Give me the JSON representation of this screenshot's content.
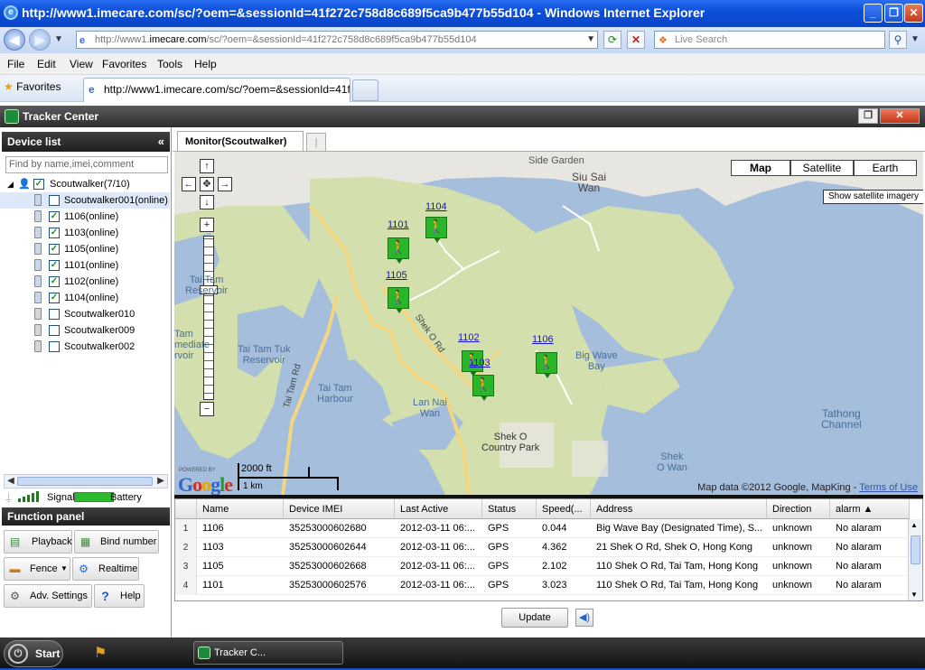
{
  "browser": {
    "title": "http://www1.imecare.com/sc/?oem=&sessionId=41f272c758d8c689f5ca9b477b55d104 - Windows Internet Explorer",
    "address_gray": "http://www1.",
    "address_host": "imecare.com",
    "address_rest": "/sc/?oem=&sessionId=41f272c758d8c689f5ca9b477b55d104",
    "search_placeholder": "Live Search",
    "menu": [
      "File",
      "Edit",
      "View",
      "Favorites",
      "Tools",
      "Help"
    ],
    "favorites_label": "Favorites",
    "tab_title": "http://www1.imecare.com/sc/?oem=&sessionId=41f2..."
  },
  "app": {
    "title": "Tracker Center",
    "device_list_header": "Device list",
    "collapse_icon": "«",
    "find_placeholder": "Find by name,imei,comment",
    "tree": {
      "group": "Scoutwalker(7/10)",
      "devices": [
        {
          "label": "Scoutwalker001(online)",
          "checked": false,
          "online": true,
          "selected": true
        },
        {
          "label": "1106(online)",
          "checked": true,
          "online": true,
          "selected": false
        },
        {
          "label": "1103(online)",
          "checked": true,
          "online": true,
          "selected": false
        },
        {
          "label": "1105(online)",
          "checked": true,
          "online": true,
          "selected": false
        },
        {
          "label": "1101(online)",
          "checked": true,
          "online": true,
          "selected": false
        },
        {
          "label": "1102(online)",
          "checked": true,
          "online": true,
          "selected": false
        },
        {
          "label": "1104(online)",
          "checked": true,
          "online": true,
          "selected": false
        },
        {
          "label": "Scoutwalker010",
          "checked": false,
          "online": false,
          "selected": false
        },
        {
          "label": "Scoutwalker009",
          "checked": false,
          "online": false,
          "selected": false
        },
        {
          "label": "Scoutwalker002",
          "checked": false,
          "online": false,
          "selected": false
        }
      ]
    },
    "signal_label": "Signal",
    "battery_label": "Battery",
    "function_panel_header": "Function panel",
    "functions": {
      "playback": "Playback",
      "bind_number": "Bind number",
      "fence": "Fence",
      "realtime": "Realtime",
      "adv_settings": "Adv. Settings",
      "help": "Help"
    },
    "monitor_tab": "Monitor(Scoutwalker)",
    "monitor_tab2": "|"
  },
  "map": {
    "type_buttons": [
      "Map",
      "Satellite",
      "Earth"
    ],
    "active_type": "Map",
    "tooltip": "Show satellite imagery",
    "labels": {
      "side_garden": "Side Garden",
      "siu_sai_wan": "Siu Sai\nWan",
      "tai_tam_reservoir": "Tai Tam\nReservoir",
      "tai_tam_tuk": "Tai Tam Tuk\nReservoir",
      "tam_mediate": "Tam\nmediate\nrvoir",
      "tai_tam_harbour": "Tai Tam\nHarbour",
      "lan_nai_wan": "Lan Nai\nWan",
      "big_wave_bay": "Big Wave\nBay",
      "shek_o_park": "Shek O\nCountry Park",
      "tathong": "Tathong\nChannel",
      "shek_o_wan": "Shek\nO Wan",
      "shek_o_rd": "Shek O Rd",
      "tai_tam_rd": "Tai Tam Rd"
    },
    "markers": [
      {
        "id": "1101"
      },
      {
        "id": "1104"
      },
      {
        "id": "1105"
      },
      {
        "id": "1102"
      },
      {
        "id": "1103"
      },
      {
        "id": "1106"
      }
    ],
    "scale_ft": "2000 ft",
    "scale_km": "1 km",
    "powered_by": "POWERED BY",
    "google": "Google",
    "attribution": "Map data ©2012 Google, MapKing - ",
    "terms": "Terms of Use"
  },
  "grid": {
    "columns": [
      "Name",
      "Device IMEI",
      "Last Active",
      "Status",
      "Speed(...",
      "Address",
      "Direction",
      "alarm ▲"
    ],
    "rows": [
      {
        "n": "1",
        "name": "1106",
        "imei": "35253000602680",
        "last": "2012-03-11 06:...",
        "status": "GPS",
        "speed": "0.044",
        "address": "Big Wave Bay (Designated Time), S...",
        "direction": "unknown",
        "alarm": "No alaram"
      },
      {
        "n": "2",
        "name": "1103",
        "imei": "35253000602644",
        "last": "2012-03-11 06:...",
        "status": "GPS",
        "speed": "4.362",
        "address": "21 Shek O Rd, Shek O, Hong Kong",
        "direction": "unknown",
        "alarm": "No alaram"
      },
      {
        "n": "3",
        "name": "1105",
        "imei": "35253000602668",
        "last": "2012-03-11 06:...",
        "status": "GPS",
        "speed": "2.102",
        "address": "110 Shek O Rd, Tai Tam, Hong Kong",
        "direction": "unknown",
        "alarm": "No alaram"
      },
      {
        "n": "4",
        "name": "1101",
        "imei": "35253000602576",
        "last": "2012-03-11 06:...",
        "status": "GPS",
        "speed": "3.023",
        "address": "110 Shek O Rd, Tai Tam, Hong Kong",
        "direction": "unknown",
        "alarm": "No alaram"
      }
    ],
    "update_button": "Update"
  },
  "taskbar": {
    "start": "Start",
    "task_item": "Tracker C..."
  },
  "colors": {
    "xp_blue": "#0c4fd8",
    "marker_green": "#29b629",
    "land": "#d6e3b3",
    "water": "#a4bedc",
    "road": "#f3d680"
  }
}
